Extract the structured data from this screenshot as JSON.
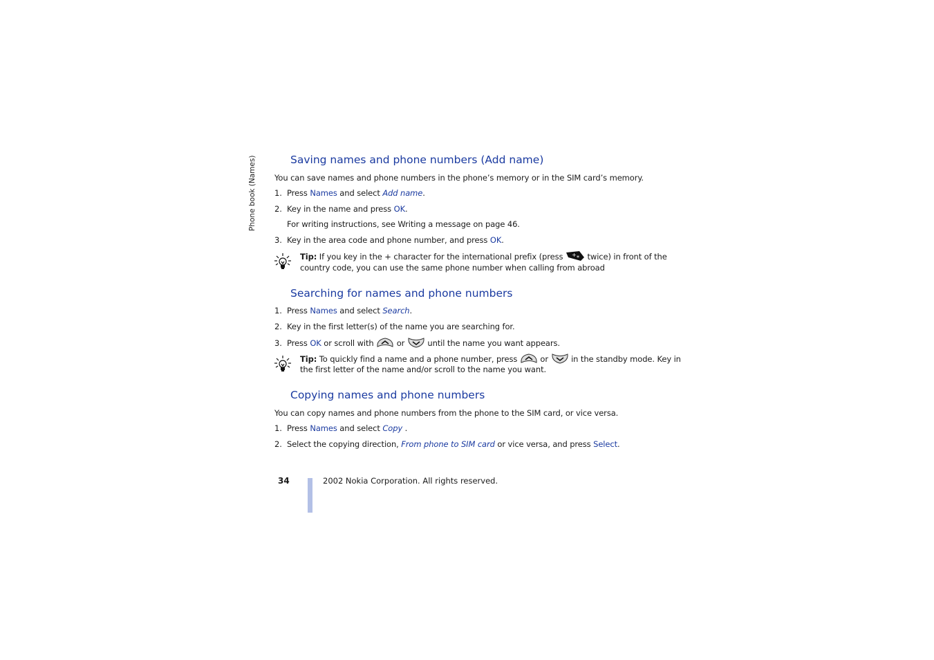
{
  "side_label": "Phone book (Names)",
  "sections": [
    {
      "heading": "Saving names and phone numbers (Add name)",
      "intro": "You can save names and phone numbers in the phone’s memory or in the SIM card’s memory.",
      "steps": [
        {
          "num": "1.",
          "pre": "Press ",
          "kw": "Names",
          "mid": " and select ",
          "it": "Add name",
          "post": "."
        },
        {
          "num": "2.",
          "pre": "Key in the name and press ",
          "kw": "OK",
          "post": "."
        },
        {
          "num": "3.",
          "pre": "Key in the area code and phone number, and press ",
          "kw": "OK",
          "post": "."
        }
      ],
      "note": "For writing instructions, see Writing a message on page 46.",
      "tip": {
        "label": "Tip:",
        "line1_pre": " If you key in the + character for the international prefix (press ",
        "key_icon": "star-plus-key-icon",
        "line1_post": " twice) in front of the",
        "line2": "country code, you can use the same phone number when calling from abroad"
      }
    },
    {
      "heading": "Searching for names and phone numbers",
      "steps": [
        {
          "num": "1.",
          "pre": "Press ",
          "kw": "Names",
          "mid": " and select ",
          "it": "Search",
          "post": "."
        },
        {
          "num": "2.",
          "pre": "Key in the first letter(s) of the name you are searching for."
        },
        {
          "num": "3.",
          "pre": "Press ",
          "kw": "OK",
          "mid": " or scroll with ",
          "or": " or ",
          "post": " until the name you want appears."
        }
      ],
      "tip": {
        "label": "Tip:",
        "line1_pre": " To quickly find a name and a phone number, press ",
        "or": " or ",
        "line1_post": " in the standby mode. Key in",
        "line2": "the first letter of the name and/or scroll to the name you want."
      }
    },
    {
      "heading": "Copying names and phone numbers",
      "intro": "You can copy names and phone numbers from the phone to the SIM card, or vice versa.",
      "steps": [
        {
          "num": "1.",
          "pre": "Press ",
          "kw": "Names",
          "mid": " and select ",
          "it": "Copy ",
          "post": "."
        },
        {
          "num": "2.",
          "pre": "Select the copying direction, ",
          "it": "From phone to SIM card",
          "mid": " or vice versa, and press ",
          "kw": "Select",
          "post": "."
        }
      ]
    }
  ],
  "footer": {
    "page_number": "34",
    "copyright": "2002 Nokia Corporation. All rights reserved."
  },
  "colors": {
    "accent": "#1a3aa0",
    "footer_bar": "#b3c0e6"
  }
}
